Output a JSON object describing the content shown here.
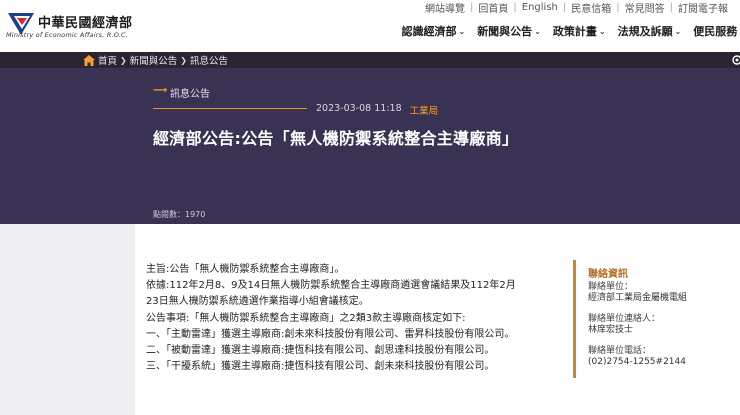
{
  "brand": {
    "name_cn": "中華民國經濟部",
    "name_en": "Ministry of Economic Affairs, R.O.C.",
    "colors": {
      "red": "#d6262b",
      "blue": "#1d3f8f"
    }
  },
  "util_links": [
    "網站導覽",
    "回首頁",
    "English",
    "民意信箱",
    "常見問答",
    "訂閱電子報"
  ],
  "nav": [
    {
      "label": "認識經濟部",
      "icon": "chevron-down-icon"
    },
    {
      "label": "新聞與公告",
      "icon": "chevron-down-icon"
    },
    {
      "label": "政策計畫",
      "icon": "chevron-down-icon"
    },
    {
      "label": "法規及訴願",
      "icon": "chevron-down-icon"
    },
    {
      "label": "便民服務",
      "icon": "chevron-down-icon"
    }
  ],
  "breadcrumb": {
    "items": [
      "首頁",
      "新聞與公告",
      "訊息公告"
    ],
    "icon": "home-icon"
  },
  "hero": {
    "category": "訊息公告",
    "date": "2023-03-08 11:18",
    "department": "工業局",
    "title": "經濟部公告:公告「無人機防禦系統整合主導廠商」",
    "clicks": "點閱數：1970",
    "colors": {
      "bg": "#3a3252",
      "accent": "#f3a12b"
    }
  },
  "article": {
    "lines": [
      "主旨:公告「無人機防禦系統整合主導廠商」。",
      "依據:112年2月8、9及14日無人機防禦系統整合主導廠商遴選會議結果及112年2月",
      "23日無人機防禦系統遴選作業指導小組會議核定。",
      "公告事項:「無人機防禦系統整合主導廠商」之2類3款主導廠商核定如下:",
      "一、「主動雷達」獲選主導廠商:創未來科技股份有限公司、雷昇科技股份有限公司。",
      "二、「被動雷達」獲選主導廠商:捷恆科技有限公司、創思達科技股份有限公司。",
      "三、「干擾系統」獲選主導廠商:捷恆科技有限公司、創未來科技股份有限公司。"
    ]
  },
  "contact": {
    "title": "聯絡資訊",
    "unit_label": "聯絡單位：",
    "unit_value": "經濟部工業局金屬機電組",
    "person_label": "聯絡單位連絡人：",
    "person_value": "林庠宏技士",
    "phone_label": "聯絡單位電話：",
    "phone_value": "(02)2754-1255#2144"
  }
}
